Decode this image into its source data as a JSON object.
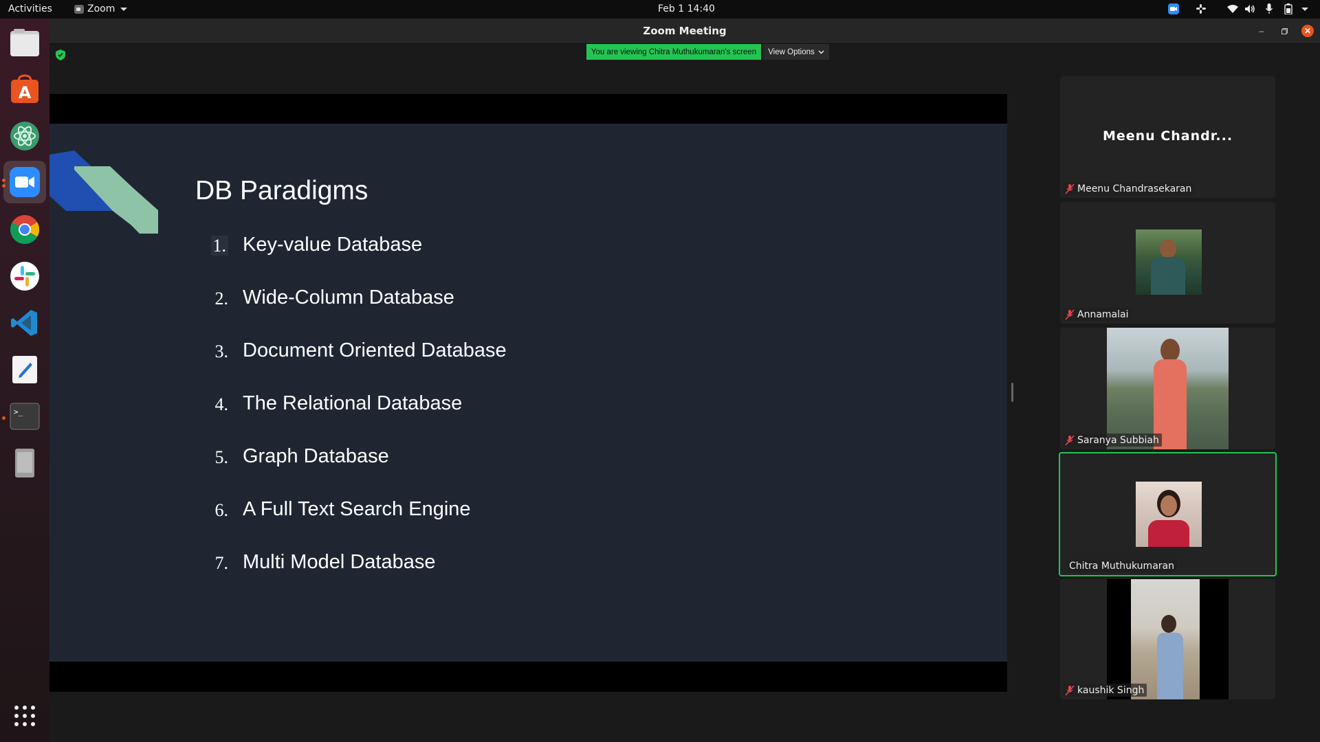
{
  "topbar": {
    "activities": "Activities",
    "app_name": "Zoom",
    "clock": "Feb 1  14:40"
  },
  "dock": {
    "items": [
      "files-icon",
      "software-store-icon",
      "atom-icon",
      "zoom-icon",
      "chrome-icon",
      "slack-icon",
      "vscode-icon",
      "text-editor-icon",
      "terminal-icon",
      "removable-drive-icon"
    ],
    "show_apps": "show-applications-icon"
  },
  "window": {
    "title": "Zoom Meeting"
  },
  "share_banner": {
    "viewing_text": "You are viewing Chitra Muthukumaran's screen",
    "view_options": "View Options"
  },
  "slide": {
    "title": "DB Paradigms",
    "items": [
      {
        "num": "1.",
        "text": "Key-value Database"
      },
      {
        "num": "2.",
        "text": "Wide-Column Database"
      },
      {
        "num": "3.",
        "text": "Document Oriented Database"
      },
      {
        "num": "4.",
        "text": "The Relational Database"
      },
      {
        "num": "5.",
        "text": "Graph Database"
      },
      {
        "num": "6.",
        "text": "A Full Text Search Engine"
      },
      {
        "num": "7.",
        "text": "Multi Model Database"
      }
    ]
  },
  "participants": [
    {
      "display": "Meenu Chandr...",
      "name": "Meenu Chandrasekaran",
      "muted": true,
      "video": false
    },
    {
      "name": "Annamalai",
      "muted": true,
      "video": true
    },
    {
      "name": "Saranya Subbiah",
      "muted": true,
      "video": true
    },
    {
      "name": "Chitra Muthukumaran",
      "muted": false,
      "video": true,
      "speaking": true
    },
    {
      "name": "kaushik Singh",
      "muted": true,
      "video": true
    }
  ],
  "colors": {
    "speaking_border": "#23c552",
    "banner": "#23c552",
    "slide_bg": "#1f2632",
    "muted_icon": "#e0464a"
  }
}
